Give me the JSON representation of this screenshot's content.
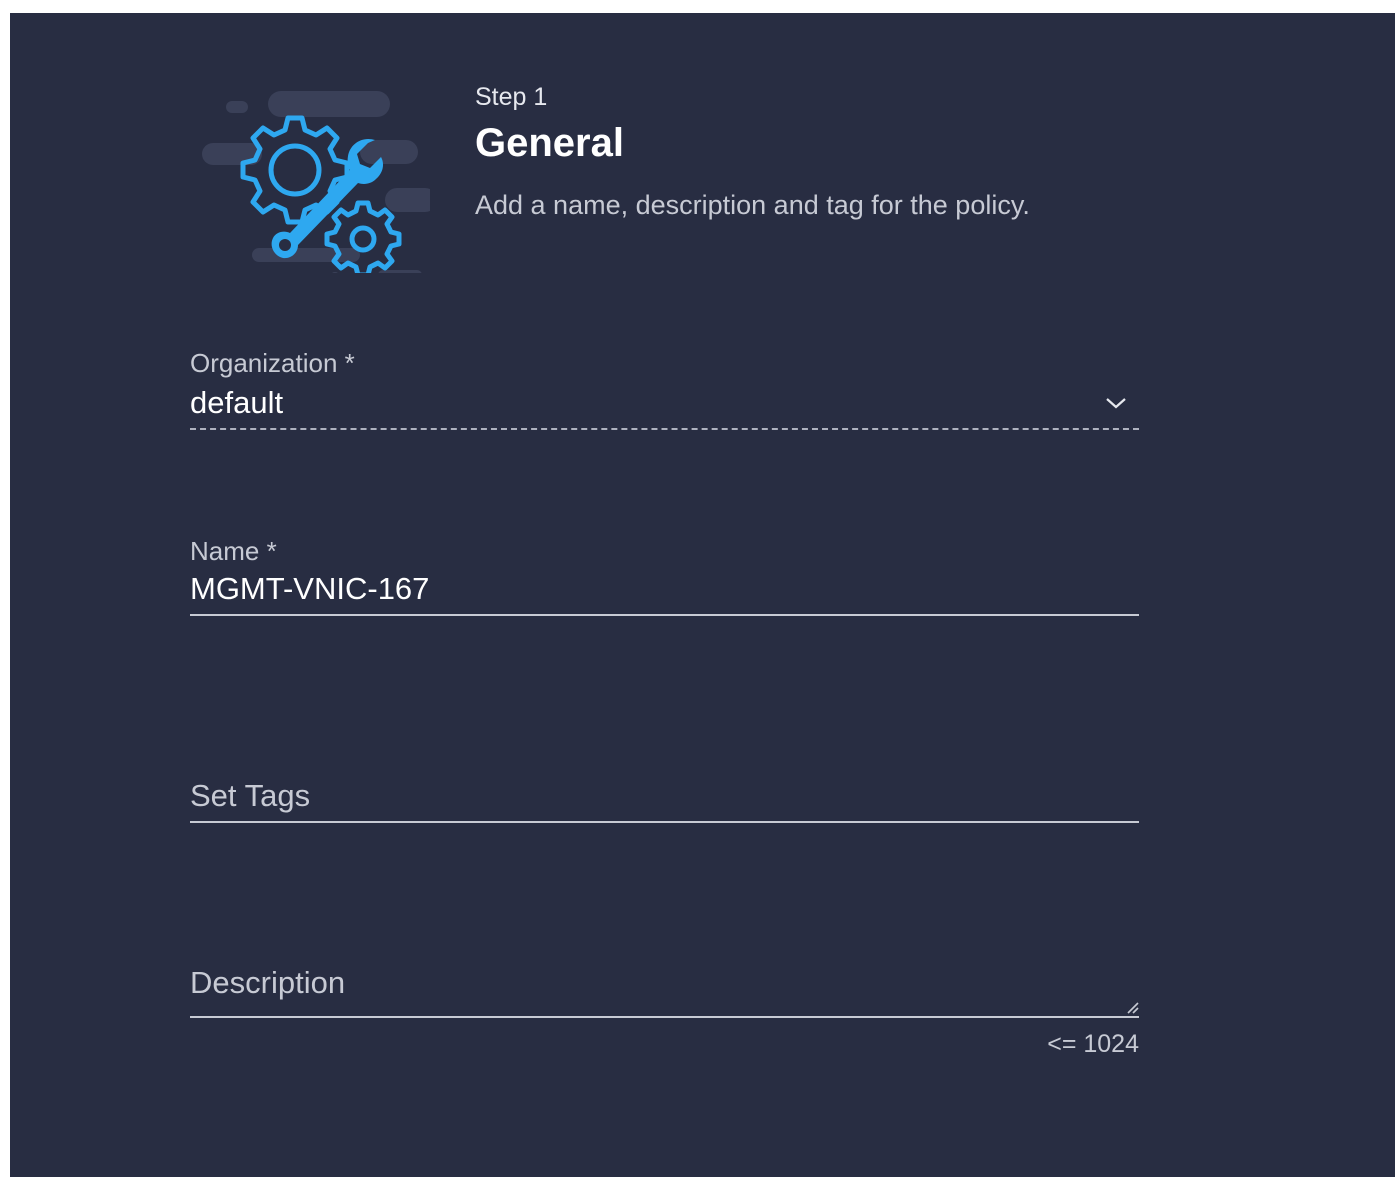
{
  "step": {
    "label": "Step 1",
    "title": "General",
    "description": "Add a name, description and tag for the policy."
  },
  "organization": {
    "label": "Organization *",
    "value": "default"
  },
  "name": {
    "label": "Name *",
    "value": "MGMT-VNIC-167"
  },
  "tags": {
    "placeholder": "Set Tags"
  },
  "description": {
    "placeholder": "Description",
    "limit": "<= 1024"
  },
  "icons": {
    "hero": "settings-wrench-gears-icon",
    "dropdown": "chevron-down-icon",
    "resize": "resize-handle-icon"
  },
  "colors": {
    "background": "#282d42",
    "accent": "#2ea8f0",
    "text": "#ffffff",
    "muted_text": "#c7cad4"
  }
}
